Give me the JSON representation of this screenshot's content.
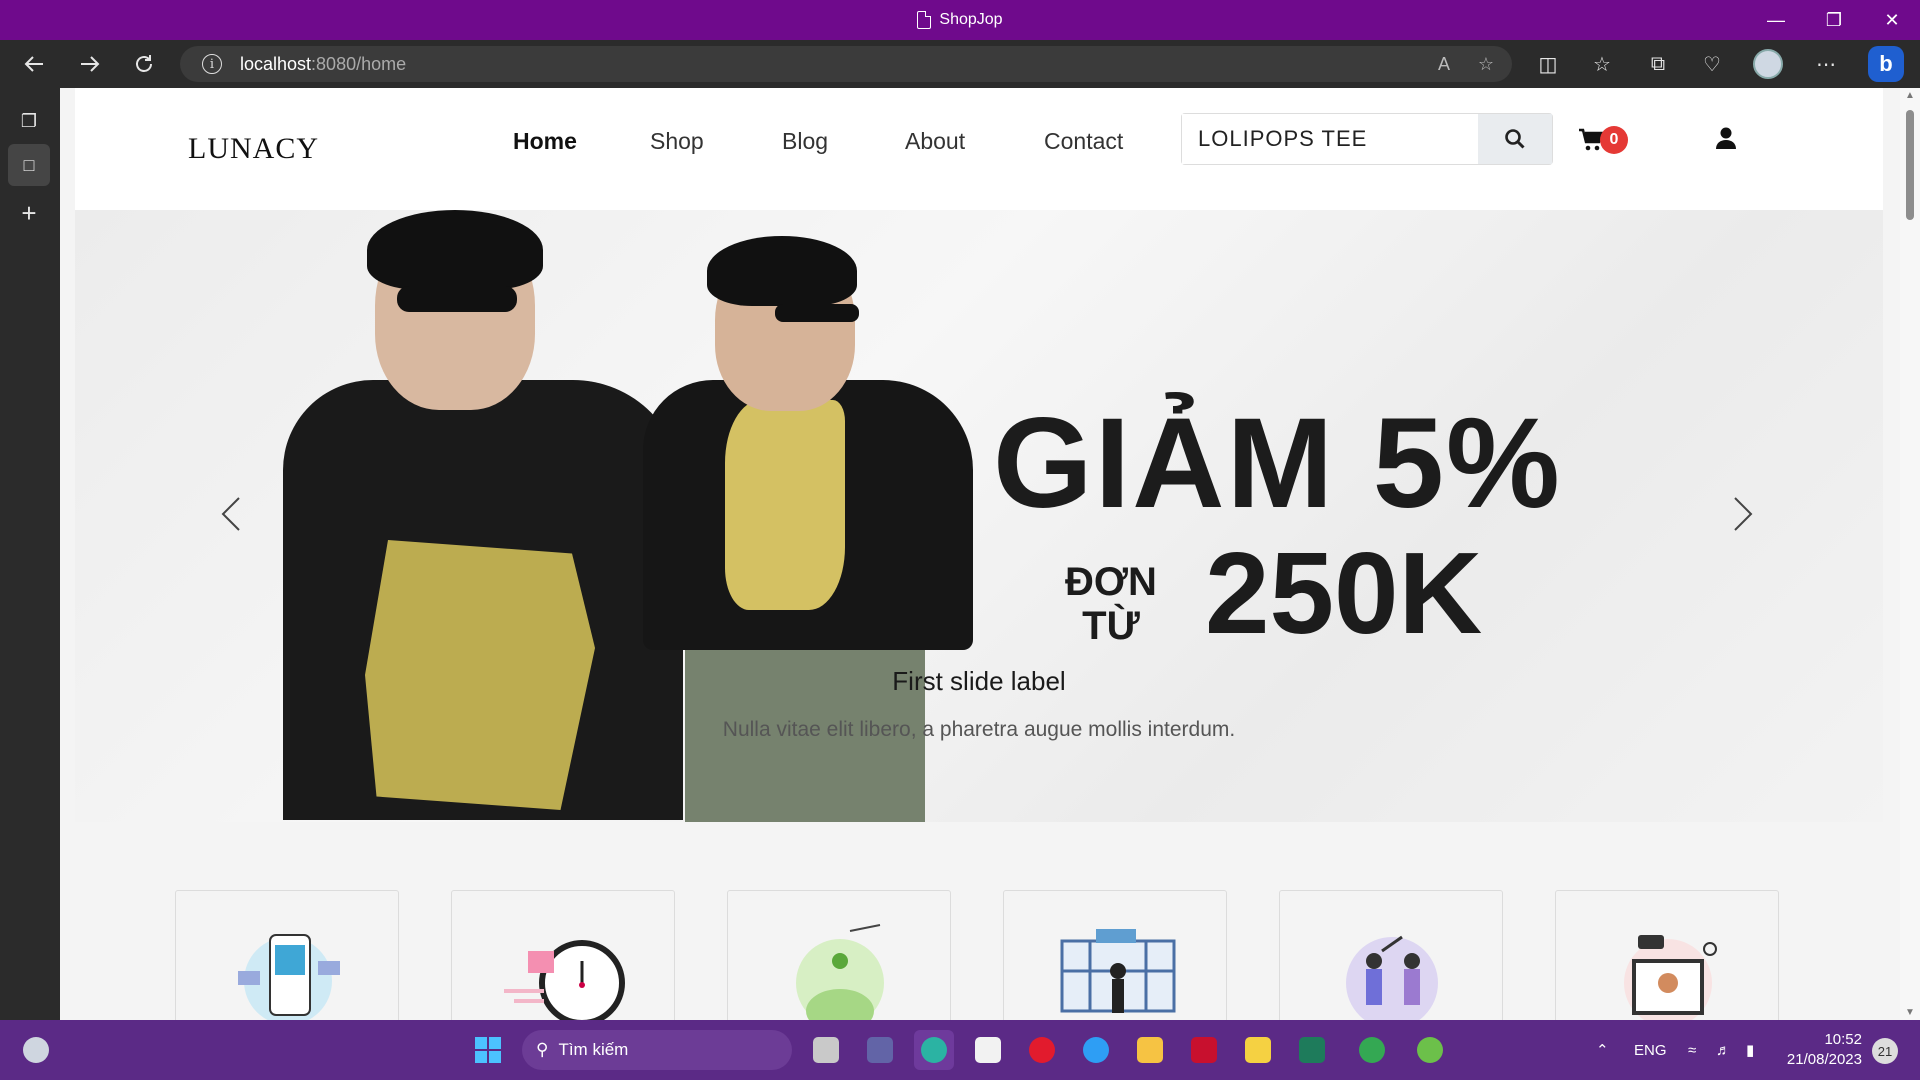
{
  "window": {
    "title": "ShopJop",
    "controls": [
      "minimize",
      "restore",
      "close"
    ]
  },
  "browser": {
    "url_host": "localhost",
    "url_path": ":8080/home",
    "toolbar_icons": [
      "read-aloud-icon",
      "favorite-star-icon",
      "split-screen-icon",
      "favorites-icon",
      "collections-icon",
      "health-icon",
      "profile-avatar",
      "more-icon",
      "bing-icon"
    ],
    "sidebar_icons": [
      "tab-actions-icon",
      "page-icon",
      "add-tab-icon"
    ]
  },
  "site": {
    "logo": "LUNACY",
    "nav": [
      {
        "label": "Home",
        "active": true
      },
      {
        "label": "Shop",
        "active": false
      },
      {
        "label": "Blog",
        "active": false
      },
      {
        "label": "About",
        "active": false
      },
      {
        "label": "Contact",
        "active": false
      }
    ],
    "search": {
      "value": "LOLIPOPS TEE",
      "placeholder": ""
    },
    "cart_count": "0"
  },
  "hero": {
    "promo_line1": "GIẢM 5%",
    "promo_line2a": "ĐƠN",
    "promo_line2b": "TỪ",
    "promo_line3": "250K",
    "caption_title": "First slide label",
    "caption_text": "Nulla vitae elit libero, a pharetra augue mollis interdum.",
    "prev_label": "Previous",
    "next_label": "Next"
  },
  "categories": [
    {
      "icon": "online-payment-illustration"
    },
    {
      "icon": "fast-delivery-illustration"
    },
    {
      "icon": "savings-illustration"
    },
    {
      "icon": "shopping-illustration"
    },
    {
      "icon": "teamwork-illustration"
    },
    {
      "icon": "online-support-illustration"
    }
  ],
  "taskbar": {
    "search_label": "Tìm kiếm",
    "language": "ENG",
    "time": "10:52",
    "date": "21/08/2023",
    "notifications": "21"
  },
  "colors": {
    "titlebar": "#6f0a8c",
    "taskbar": "#5b2a86",
    "cart_badge": "#e53935"
  }
}
